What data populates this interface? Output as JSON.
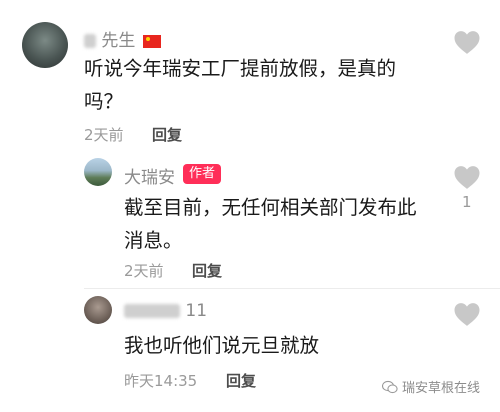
{
  "comments": [
    {
      "username": "先生",
      "text_line1": "听说今年瑞安工厂提前放假，是真的",
      "text_line2": "吗？",
      "time": "2天前",
      "reply_label": "回复",
      "like_count": ""
    },
    {
      "username": "大瑞安",
      "badge": "作者",
      "text_line1": "截至目前，无任何相关部门发布此",
      "text_line2": "消息。",
      "time": "2天前",
      "reply_label": "回复",
      "like_count": "1"
    },
    {
      "username": "11",
      "text_line1": "我也听他们说元旦就放",
      "time": "昨天14:35",
      "reply_label": "回复",
      "like_count": ""
    }
  ],
  "watermark": "瑞安草根在线",
  "colors": {
    "heart": "#c8c8c8",
    "badge": "#ff2e58"
  },
  "icons": [
    "heart-icon",
    "flag-icon",
    "wechat-icon"
  ]
}
